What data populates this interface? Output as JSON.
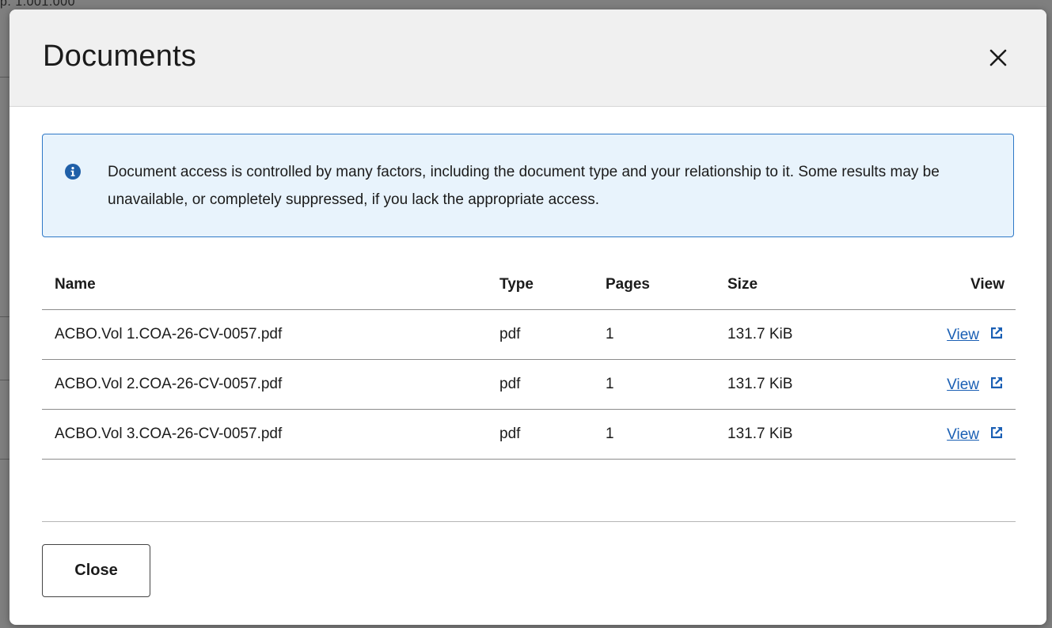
{
  "backdrop": {
    "snippet": "p. 1.001.000"
  },
  "modal": {
    "title": "Documents",
    "close_icon": "close-icon"
  },
  "alert": {
    "icon": "info-icon",
    "text": "Document access is controlled by many factors, including the document type and your relationship to it. Some results may be unavailable, or completely suppressed, if you lack the appropriate access.",
    "color_border": "#2e78c7",
    "color_bg": "#e8f3fc"
  },
  "table": {
    "headers": {
      "name": "Name",
      "type": "Type",
      "pages": "Pages",
      "size": "Size",
      "view": "View"
    },
    "rows": [
      {
        "name": "ACBO.Vol 1.COA-26-CV-0057.pdf",
        "type": "pdf",
        "pages": "1",
        "size": "131.7 KiB",
        "view": "View",
        "view_icon": "external-link-icon"
      },
      {
        "name": "ACBO.Vol 2.COA-26-CV-0057.pdf",
        "type": "pdf",
        "pages": "1",
        "size": "131.7 KiB",
        "view": "View",
        "view_icon": "external-link-icon"
      },
      {
        "name": "ACBO.Vol 3.COA-26-CV-0057.pdf",
        "type": "pdf",
        "pages": "1",
        "size": "131.7 KiB",
        "view": "View",
        "view_icon": "external-link-icon"
      }
    ]
  },
  "footer": {
    "close_label": "Close"
  },
  "colors": {
    "link": "#1a5fb4",
    "header_bg": "#f0f0f0"
  }
}
